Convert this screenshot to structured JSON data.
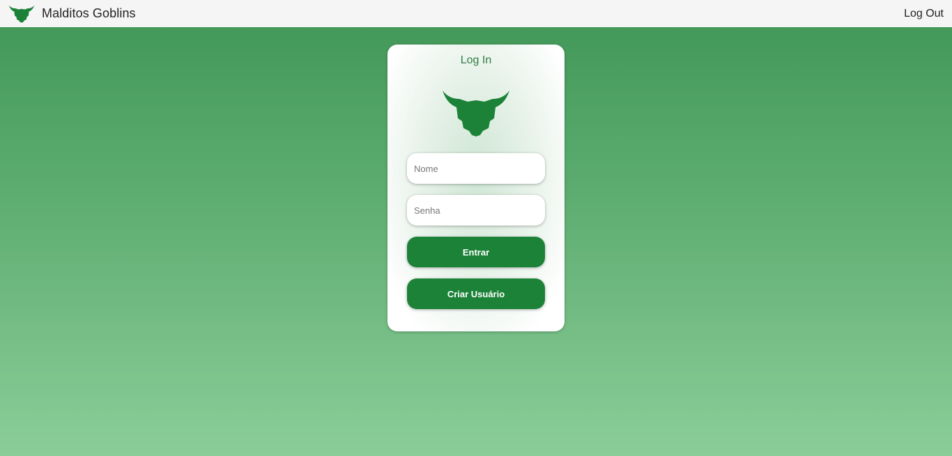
{
  "navbar": {
    "logo_icon": "goblin-head-icon",
    "title": "Malditos Goblins",
    "logout_label": "Log Out"
  },
  "login_card": {
    "title": "Log In",
    "logo_icon": "goblin-head-icon",
    "name_field": {
      "placeholder": "Nome",
      "value": ""
    },
    "password_field": {
      "placeholder": "Senha",
      "value": ""
    },
    "enter_button_label": "Entrar",
    "create_user_button_label": "Criar Usuário"
  },
  "colors": {
    "brand_green": "#1b8238",
    "title_green": "#2e7d44",
    "background_top": "#3f9656",
    "background_bottom": "#8bcd99",
    "navbar_bg": "#f5f5f5"
  }
}
